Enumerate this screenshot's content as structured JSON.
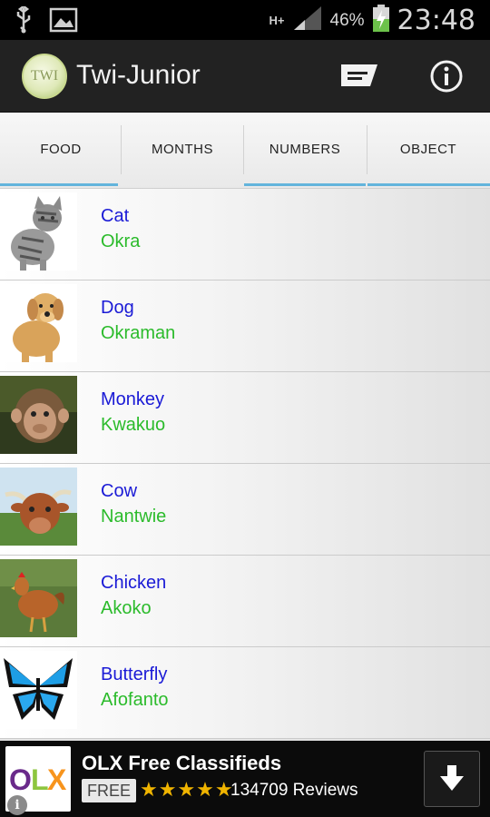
{
  "status_bar": {
    "network": "H+",
    "battery_percent": "46%",
    "time": "23:48",
    "icons": [
      "usb-icon",
      "image-icon",
      "signal-icon",
      "battery-charging-icon"
    ]
  },
  "action_bar": {
    "logo_text": "TWI",
    "title": "Twi-Junior",
    "icons": [
      "message-icon",
      "info-icon"
    ]
  },
  "tabs": [
    {
      "label": "FOOD"
    },
    {
      "label": "MONTHS"
    },
    {
      "label": "NUMBERS"
    },
    {
      "label": "OBJECT"
    }
  ],
  "list": {
    "items": [
      {
        "english": "Cat",
        "twi": "Okra",
        "image": "cat-image"
      },
      {
        "english": "Dog",
        "twi": "Okraman",
        "image": "dog-image"
      },
      {
        "english": "Monkey",
        "twi": "Kwakuo",
        "image": "monkey-image"
      },
      {
        "english": "Cow",
        "twi": "Nantwie",
        "image": "cow-image"
      },
      {
        "english": "Chicken",
        "twi": "Akoko",
        "image": "chicken-image"
      },
      {
        "english": "Butterfly",
        "twi": "Afofanto",
        "image": "butterfly-image"
      }
    ]
  },
  "ad": {
    "logo_text": "OLX",
    "title": "OLX Free Classifieds",
    "price_badge": "FREE",
    "rating": 4.5,
    "stars": "★★★★★",
    "reviews": "134709 Reviews",
    "info_glyph": "i"
  },
  "colors": {
    "english_word": "#1a1ad6",
    "twi_word": "#2bbb2b",
    "tab_indicator": "#63b4dc",
    "action_bar": "#222222"
  }
}
